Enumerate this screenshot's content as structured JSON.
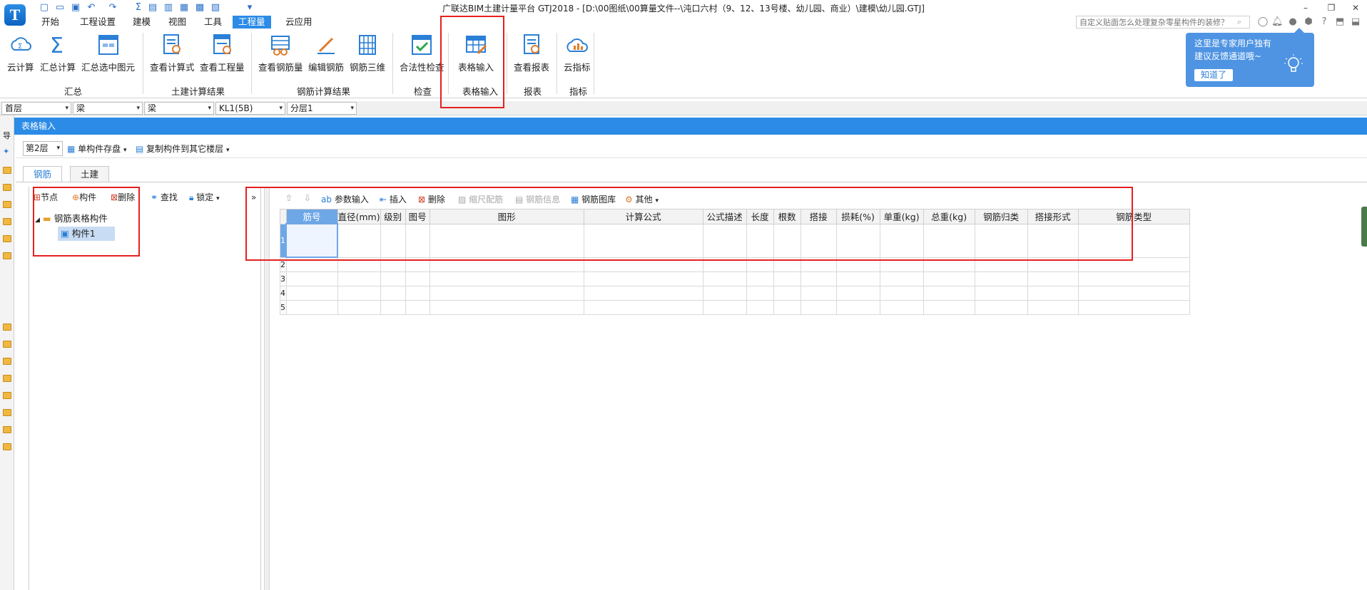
{
  "app": {
    "window_title": "广联达BIM土建计量平台 GTJ2018 - [D:\\00图纸\\00算量文件--\\沌口六村（9、12、13号楼、幼儿园、商业）\\建模\\幼儿园.GTJ]",
    "logo_letter": "T",
    "help_search_placeholder": "自定义贴面怎么处理复杂零星构件的装修？"
  },
  "menu": {
    "tabs": [
      "开始",
      "工程设置",
      "建模",
      "视图",
      "工具",
      "工程量",
      "云应用"
    ],
    "active": "工程量"
  },
  "ribbon": {
    "buttons": {
      "cloud_calc": "云计算",
      "sum_calc": "汇总计算",
      "sum_selected": "汇总选中图元",
      "view_formula": "查看计算式",
      "view_quantity": "查看工程量",
      "view_rebar_qty": "查看钢筋量",
      "edit_rebar": "编辑钢筋",
      "rebar_3d": "钢筋三维",
      "legality_check": "合法性检查",
      "table_input": "表格输入",
      "view_report": "查看报表",
      "cloud_index": "云指标"
    },
    "groups": {
      "summary": "汇总",
      "civil_result": "土建计算结果",
      "rebar_result": "钢筋计算结果",
      "check": "检查",
      "table_input": "表格输入",
      "report": "报表",
      "index": "指标"
    }
  },
  "tooltip": {
    "line1": "这里是专家用户独有",
    "line2": "建议反馈通道哦~",
    "ok_label": "知道了"
  },
  "selectors": {
    "floor": "首层",
    "type1": "梁",
    "type2": "梁",
    "component": "KL1(5B)",
    "layer": "分层1"
  },
  "panel": {
    "title": "表格输入",
    "floor_value": "第2层",
    "save_component": "单构件存盘",
    "copy_to_floor": "复制构件到其它楼层",
    "tabs": [
      "钢筋",
      "土建"
    ],
    "active_tab": "钢筋"
  },
  "left_strip_label": "导",
  "tree": {
    "toolbar": {
      "node": "节点",
      "component": "构件",
      "delete": "删除",
      "find": "查找",
      "lock": "锁定"
    },
    "root_label": "钢筋表格构件",
    "child_label": "构件1"
  },
  "grid_toolbar": {
    "param_input": "参数输入",
    "insert": "插入",
    "delete": "删除",
    "scale_rebar": "缩尺配筋",
    "rebar_info": "钢筋信息",
    "rebar_library": "钢筋图库",
    "other": "其他"
  },
  "grid": {
    "columns": [
      "筋号",
      "直径(mm)",
      "级别",
      "图号",
      "图形",
      "计算公式",
      "公式描述",
      "长度",
      "根数",
      "搭接",
      "损耗(%)",
      "单重(kg)",
      "总重(kg)",
      "钢筋归类",
      "搭接形式",
      "钢筋类型"
    ],
    "row_numbers": [
      "1",
      "2",
      "3",
      "4",
      "5"
    ]
  }
}
